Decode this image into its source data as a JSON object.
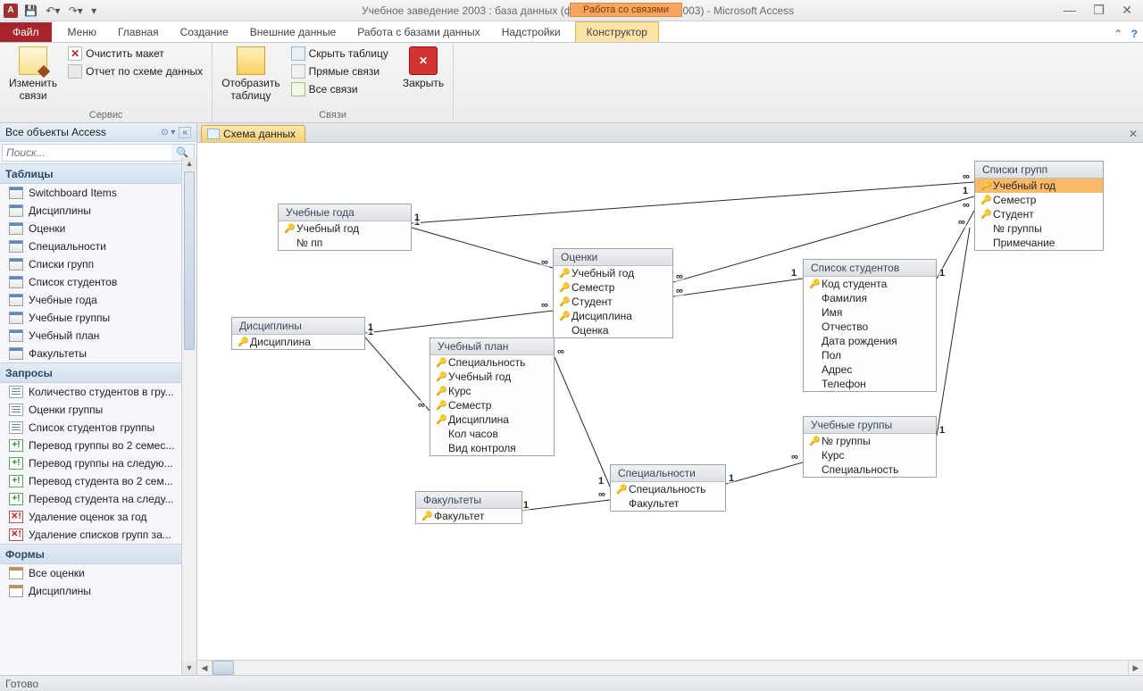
{
  "titlebar": {
    "app_letter": "A",
    "title": "Учебное заведение 2003 : база данных (формат Access 2002 - 2003)  -  Microsoft Access",
    "context_label": "Работа со связями"
  },
  "tabs": {
    "file": "Файл",
    "menu": "Меню",
    "home": "Главная",
    "create": "Создание",
    "external": "Внешние данные",
    "dbtools": "Работа с базами данных",
    "addins": "Надстройки",
    "design": "Конструктор"
  },
  "ribbon": {
    "group1_label": "Сервис",
    "edit_rel": "Изменить\nсвязи",
    "clear_layout": "Очистить макет",
    "rel_report": "Отчет по схеме данных",
    "group2_btn": "Отобразить\nтаблицу",
    "hide_table": "Скрыть таблицу",
    "direct_rel": "Прямые связи",
    "all_rel": "Все связи",
    "group2_label": "Связи",
    "close": "Закрыть"
  },
  "nav": {
    "header": "Все объекты Access",
    "search_placeholder": "Поиск...",
    "cat_tables": "Таблицы",
    "cat_queries": "Запросы",
    "cat_forms": "Формы",
    "tables": [
      "Switchboard Items",
      "Дисциплины",
      "Оценки",
      "Специальности",
      "Списки групп",
      "Список студентов",
      "Учебные года",
      "Учебные группы",
      "Учебный план",
      "Факультеты"
    ],
    "queries": [
      {
        "t": "sel",
        "n": "Количество студентов в гру..."
      },
      {
        "t": "sel",
        "n": "Оценки группы"
      },
      {
        "t": "sel",
        "n": "Список студентов группы"
      },
      {
        "t": "act",
        "n": "Перевод группы во 2 семес..."
      },
      {
        "t": "act",
        "n": "Перевод группы на следую..."
      },
      {
        "t": "act",
        "n": "Перевод студента во 2 сем..."
      },
      {
        "t": "act",
        "n": "Перевод студента на следу..."
      },
      {
        "t": "del",
        "n": "Удаление оценок за год"
      },
      {
        "t": "del",
        "n": "Удаление списков групп за..."
      }
    ],
    "forms": [
      "Все оценки",
      "Дисциплины"
    ]
  },
  "doctab": "Схема данных",
  "status": "Готово",
  "boxes": {
    "uchgoda": {
      "title": "Учебные года",
      "fields": [
        {
          "k": true,
          "n": "Учебный год"
        },
        {
          "k": false,
          "n": "№ пп"
        }
      ]
    },
    "disc": {
      "title": "Дисциплины",
      "fields": [
        {
          "k": true,
          "n": "Дисциплина"
        }
      ]
    },
    "ocenki": {
      "title": "Оценки",
      "fields": [
        {
          "k": true,
          "n": "Учебный год"
        },
        {
          "k": true,
          "n": "Семестр"
        },
        {
          "k": true,
          "n": "Студент"
        },
        {
          "k": true,
          "n": "Дисциплина"
        },
        {
          "k": false,
          "n": "Оценка"
        }
      ]
    },
    "uchplan": {
      "title": "Учебный план",
      "fields": [
        {
          "k": true,
          "n": "Специальность"
        },
        {
          "k": true,
          "n": "Учебный год"
        },
        {
          "k": true,
          "n": "Курс"
        },
        {
          "k": true,
          "n": "Семестр"
        },
        {
          "k": true,
          "n": "Дисциплина"
        },
        {
          "k": false,
          "n": "Кол часов"
        },
        {
          "k": false,
          "n": "Вид контроля"
        }
      ]
    },
    "fac": {
      "title": "Факультеты",
      "fields": [
        {
          "k": true,
          "n": "Факультет"
        }
      ]
    },
    "spec": {
      "title": "Специальности",
      "fields": [
        {
          "k": true,
          "n": "Специальность"
        },
        {
          "k": false,
          "n": "Факультет"
        }
      ]
    },
    "spisst": {
      "title": "Список студентов",
      "fields": [
        {
          "k": true,
          "n": "Код студента"
        },
        {
          "k": false,
          "n": "Фамилия"
        },
        {
          "k": false,
          "n": "Имя"
        },
        {
          "k": false,
          "n": "Отчество"
        },
        {
          "k": false,
          "n": "Дата рождения"
        },
        {
          "k": false,
          "n": "Пол"
        },
        {
          "k": false,
          "n": "Адрес"
        },
        {
          "k": false,
          "n": "Телефон"
        }
      ]
    },
    "uchgr": {
      "title": "Учебные группы",
      "fields": [
        {
          "k": true,
          "n": "№ группы"
        },
        {
          "k": false,
          "n": "Курс"
        },
        {
          "k": false,
          "n": "Специальность"
        }
      ]
    },
    "spgr": {
      "title": "Списки групп",
      "fields": [
        {
          "k": true,
          "n": "Учебный год",
          "sel": true
        },
        {
          "k": true,
          "n": "Семестр"
        },
        {
          "k": true,
          "n": "Студент"
        },
        {
          "k": false,
          "n": "№ группы"
        },
        {
          "k": false,
          "n": "Примечание"
        }
      ]
    }
  },
  "inf": "∞",
  "one": "1"
}
